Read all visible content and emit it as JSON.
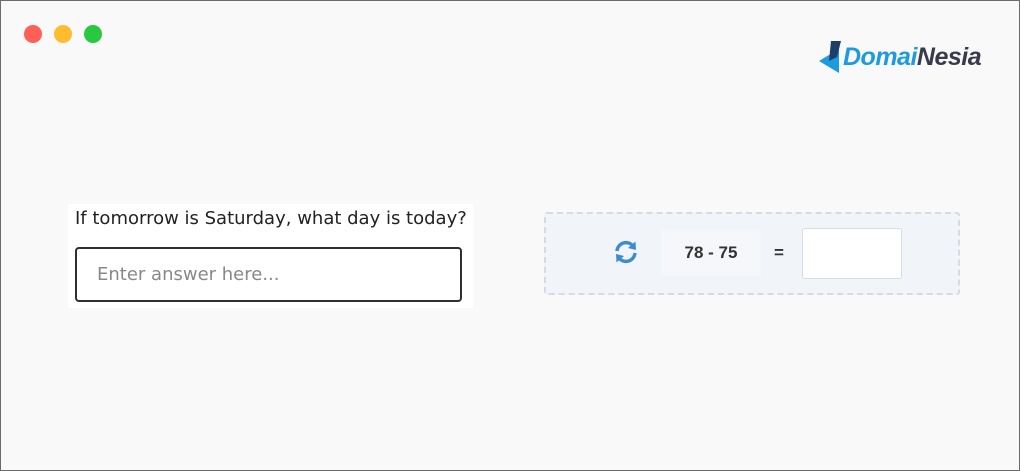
{
  "window": {
    "controls": [
      "close",
      "minimize",
      "maximize"
    ]
  },
  "brand": {
    "name_part1": "Domai",
    "name_part2": "Nesia",
    "colors": {
      "accent": "#1e9ae0",
      "dark": "#3a3a4a"
    }
  },
  "question": {
    "text": "If tomorrow is Saturday, what day is today?",
    "answer_value": "",
    "answer_placeholder": "Enter answer here..."
  },
  "captcha": {
    "refresh_icon": "refresh-icon",
    "expression": "78 - 75",
    "equals": "=",
    "result_value": ""
  }
}
